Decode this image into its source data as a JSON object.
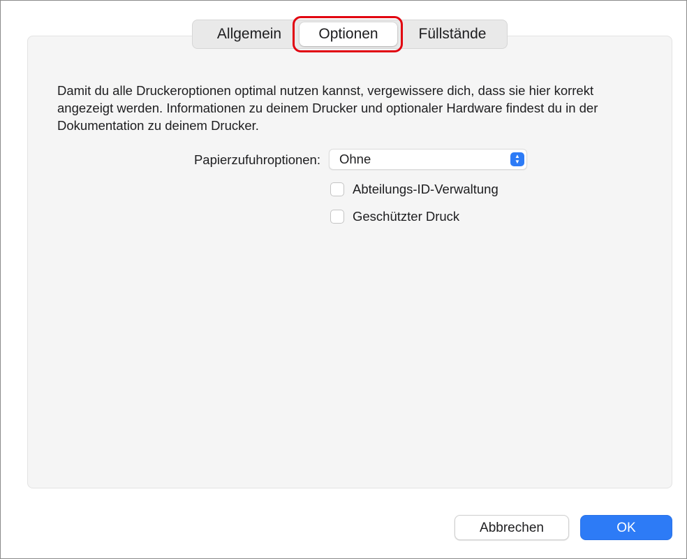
{
  "tabs": {
    "items": [
      {
        "label": "Allgemein"
      },
      {
        "label": "Optionen"
      },
      {
        "label": "Füllstände"
      }
    ],
    "active_index": 1
  },
  "description": "Damit du alle Druckeroptionen optimal nutzen kannst, vergewissere dich, dass sie hier korrekt angezeigt werden. Informationen zu deinem Drucker und optionaler Hardware findest du in der Dokumentation zu deinem Drucker.",
  "paper_feed": {
    "label": "Papierzufuhroptionen:",
    "value": "Ohne"
  },
  "checkboxes": [
    {
      "label": "Abteilungs-ID-Verwaltung",
      "checked": false
    },
    {
      "label": "Geschützter Druck",
      "checked": false
    }
  ],
  "buttons": {
    "cancel": "Abbrechen",
    "ok": "OK"
  },
  "colors": {
    "accent": "#2d7bf6",
    "highlight": "#e1000f"
  }
}
